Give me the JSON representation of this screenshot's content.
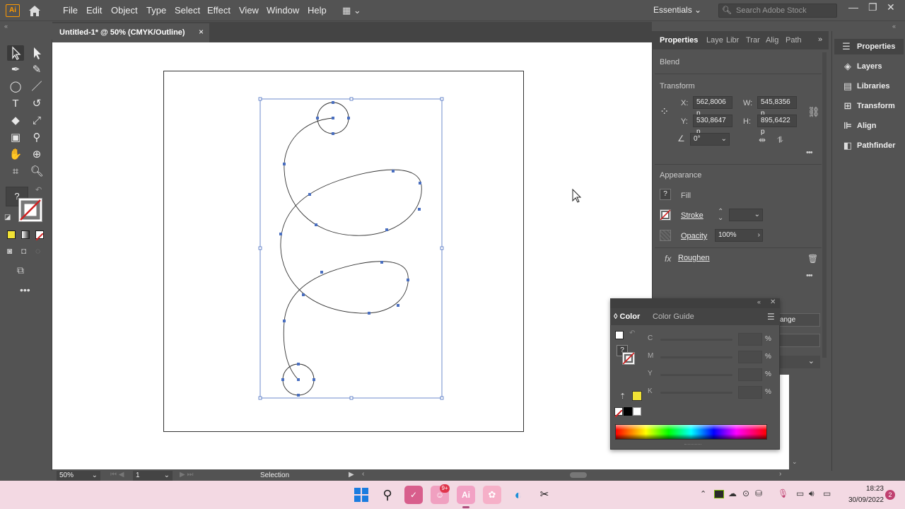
{
  "app": {
    "logo_text": "Ai",
    "menus": [
      "File",
      "Edit",
      "Object",
      "Type",
      "Select",
      "Effect",
      "View",
      "Window",
      "Help"
    ],
    "workspace": "Essentials",
    "search_placeholder": "Search Adobe Stock"
  },
  "document": {
    "tab_title": "Untitled-1* @ 50% (CMYK/Outline)",
    "close": "×"
  },
  "statusbar": {
    "zoom": "50%",
    "page": "1",
    "tool": "Selection"
  },
  "properties": {
    "tabs": [
      "Properties",
      "Laye",
      "Libr",
      "Trar",
      "Alig",
      "Path"
    ],
    "blend_label": "Blend",
    "transform_title": "Transform",
    "x_label": "X:",
    "x_value": "562,8006 p",
    "y_label": "Y:",
    "y_value": "530,8647 p",
    "w_label": "W:",
    "w_value": "545,8356 p",
    "h_label": "H:",
    "h_value": "895,6422 p",
    "angle_value": "0°",
    "appearance_title": "Appearance",
    "fill_label": "Fill",
    "stroke_label": "Stroke",
    "opacity_label": "Opacity",
    "opacity_value": "100%",
    "effect_label": "Roughen",
    "partial_button": "ange"
  },
  "dock": {
    "items": [
      "Properties",
      "Layers",
      "Libraries",
      "Transform",
      "Align",
      "Pathfinder"
    ]
  },
  "color_panel": {
    "tabs": [
      "Color",
      "Color Guide"
    ],
    "channels": [
      "C",
      "M",
      "Y",
      "K"
    ],
    "percent": "%"
  },
  "taskbar": {
    "time": "18:23",
    "date": "30/09/2022",
    "badge": "9+",
    "notification_count": "2"
  },
  "colors": {
    "fill_swatch": "#f2e335",
    "selection_blue": "#4a6fc0",
    "ui_gray": "#535353",
    "taskbar": "#f3d9e3"
  }
}
